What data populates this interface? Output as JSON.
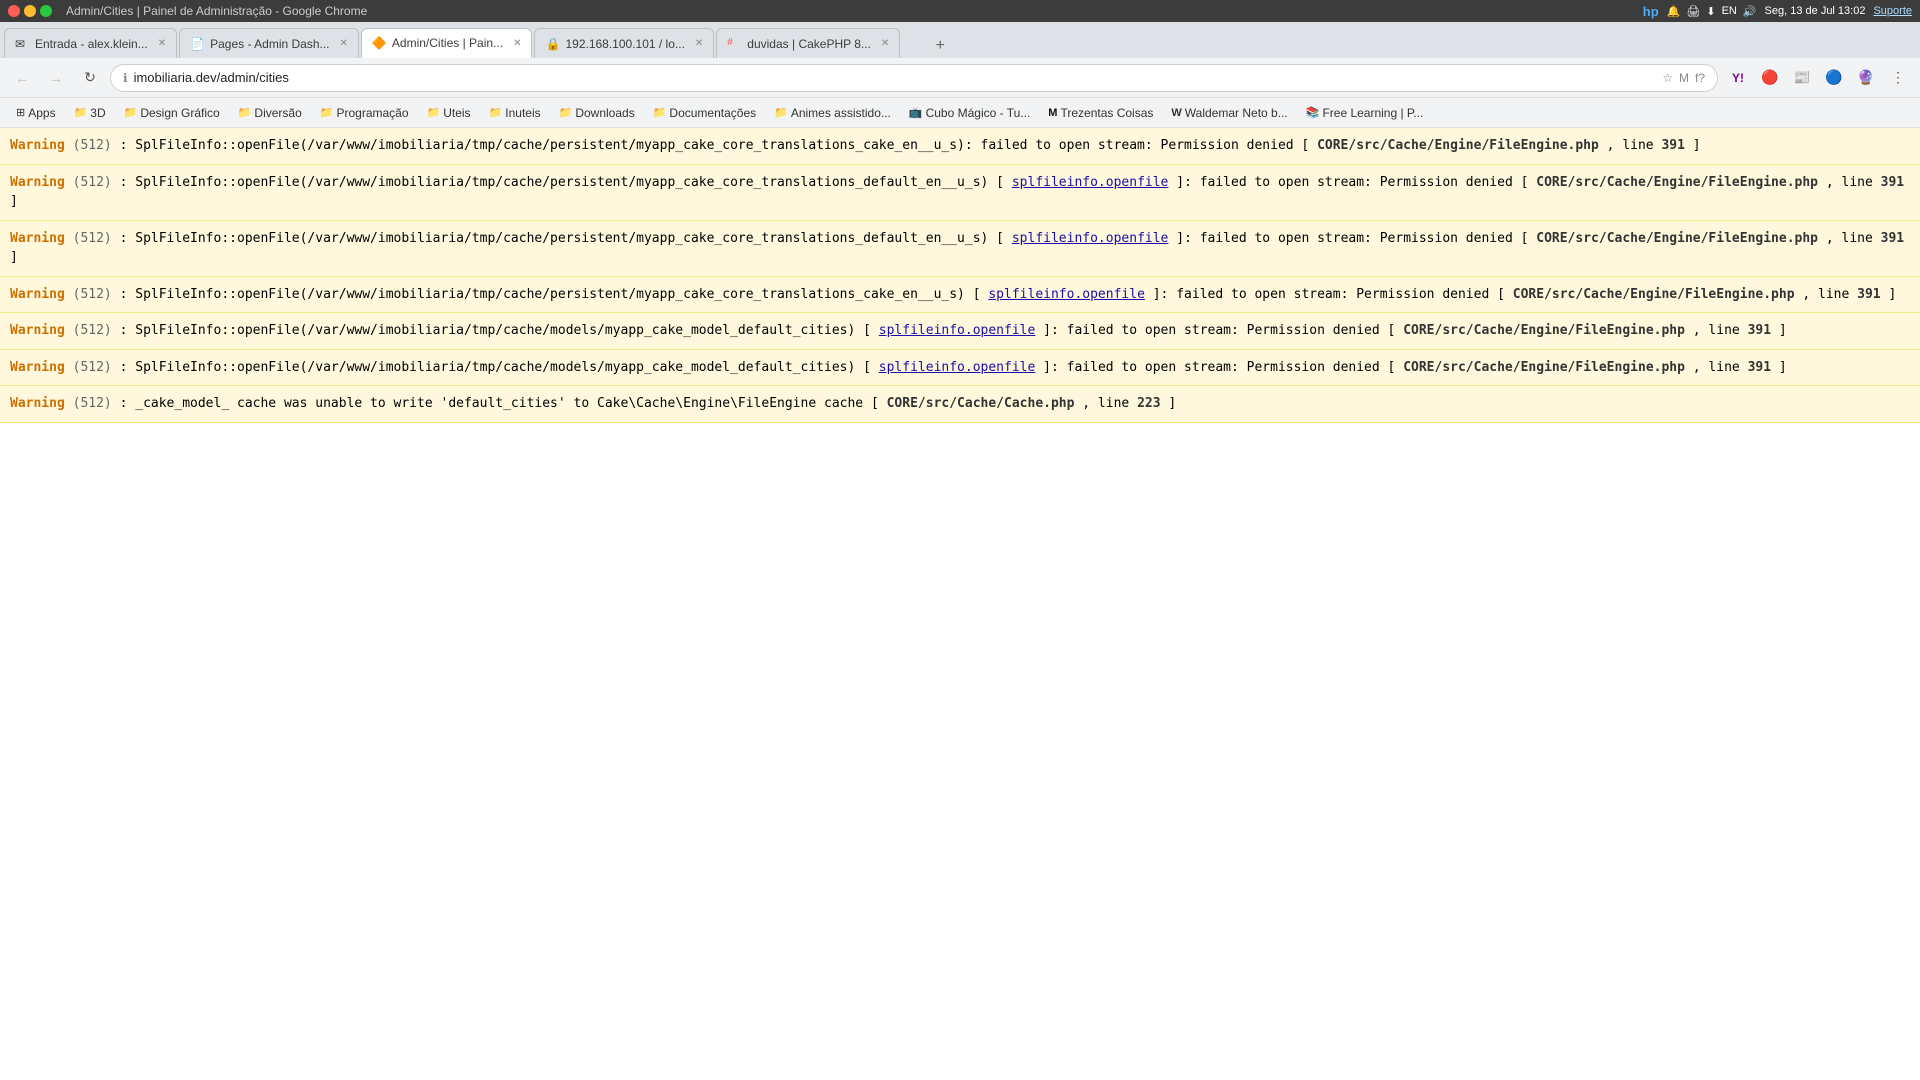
{
  "titleBar": {
    "title": "Admin/Cities | Painel de Administração - Google Chrome",
    "time": "Seg, 13 de Jul 13:02",
    "support": "Suporte"
  },
  "tabs": [
    {
      "id": "tab1",
      "label": "Entrada - alex.klein...",
      "favicon": "✉",
      "active": false,
      "closable": true
    },
    {
      "id": "tab2",
      "label": "Pages - Admin Dash...",
      "favicon": "📄",
      "active": false,
      "closable": true
    },
    {
      "id": "tab3",
      "label": "Admin/Cities | Pain...",
      "favicon": "🔶",
      "active": true,
      "closable": true
    },
    {
      "id": "tab4",
      "label": "192.168.100.101 / lo...",
      "favicon": "🔒",
      "active": false,
      "closable": true
    },
    {
      "id": "tab5",
      "label": "duvidas | CakePHP 8...",
      "favicon": "#",
      "active": false,
      "closable": true
    }
  ],
  "addressBar": {
    "url": "imobiliaria.dev/admin/cities",
    "secure": false
  },
  "bookmarks": [
    {
      "label": "Apps",
      "icon": "⊞",
      "type": "apps"
    },
    {
      "label": "3D",
      "icon": "📁",
      "type": "folder"
    },
    {
      "label": "Design Gráfico",
      "icon": "📁",
      "type": "folder"
    },
    {
      "label": "Diversão",
      "icon": "📁",
      "type": "folder"
    },
    {
      "label": "Programação",
      "icon": "📁",
      "type": "folder"
    },
    {
      "label": "Uteis",
      "icon": "📁",
      "type": "folder"
    },
    {
      "label": "Inuteis",
      "icon": "📁",
      "type": "folder"
    },
    {
      "label": "Downloads",
      "icon": "📁",
      "type": "folder"
    },
    {
      "label": "Documentações",
      "icon": "📁",
      "type": "folder"
    },
    {
      "label": "Animes assistido...",
      "icon": "📁",
      "type": "folder"
    },
    {
      "label": "Cubo Mágico - Tu...",
      "icon": "📺",
      "type": "link"
    },
    {
      "label": "Trezentas Coisas",
      "icon": "M",
      "type": "link"
    },
    {
      "label": "Waldemar Neto b...",
      "icon": "W",
      "type": "link"
    },
    {
      "label": "Free Learning | P...",
      "icon": "📚",
      "type": "link"
    }
  ],
  "warnings": [
    {
      "label": "Warning",
      "code": "(512)",
      "message": "SplFileInfo::openFile(/var/www/imobiliaria/tmp/cache/persistent/myapp_cake_core_translations_cake_en__u_s): failed to open stream: Permission denied",
      "link": null,
      "file": "CORE/src/Cache/Engine/FileEngine.php",
      "line": "391"
    },
    {
      "label": "Warning",
      "code": "(512)",
      "message": "SplFileInfo::openFile(/var/www/imobiliaria/tmp/cache/persistent/myapp_cake_core_translations_default_en__u_s)",
      "link": "splfileinfo.openfile",
      "link_suffix": ": failed to open stream: Permission denied",
      "file": "CORE/src/Cache/Engine/FileEngine.php",
      "line": "391"
    },
    {
      "label": "Warning",
      "code": "(512)",
      "message": "SplFileInfo::openFile(/var/www/imobiliaria/tmp/cache/persistent/myapp_cake_core_translations_default_en__u_s)",
      "link": "splfileinfo.openfile",
      "link_suffix": ": failed to open stream: Permission denied",
      "file": "CORE/src/Cache/Engine/FileEngine.php",
      "line": "391"
    },
    {
      "label": "Warning",
      "code": "(512)",
      "message": "SplFileInfo::openFile(/var/www/imobiliaria/tmp/cache/persistent/myapp_cake_core_translations_cake_en__u_s)",
      "link": "splfileinfo.openfile",
      "link_suffix": ": failed to open stream: Permission denied",
      "file": "CORE/src/Cache/Engine/FileEngine.php",
      "line": "391"
    },
    {
      "label": "Warning",
      "code": "(512)",
      "message": "SplFileInfo::openFile(/var/www/imobiliaria/tmp/cache/models/myapp_cake_model_default_cities)",
      "link": "splfileinfo.openfile",
      "link_suffix": ": failed to open stream: Permission denied",
      "file": "CORE/src/Cache/Engine/FileEngine.php",
      "line": "391"
    },
    {
      "label": "Warning",
      "code": "(512)",
      "message": "SplFileInfo::openFile(/var/www/imobiliaria/tmp/cache/models/myapp_cake_model_default_cities)",
      "link": "splfileinfo.openfile",
      "link_suffix": ": failed to open stream: Permission denied",
      "file": "CORE/src/Cache/Engine/FileEngine.php",
      "line": "391"
    },
    {
      "label": "Warning",
      "code": "(512)",
      "message": "_cake_model_ cache was unable to write 'default_cities' to Cake\\Cache\\Engine\\FileEngine cache",
      "link": null,
      "file": "CORE/src/Cache/Cache.php",
      "line": "223"
    }
  ]
}
